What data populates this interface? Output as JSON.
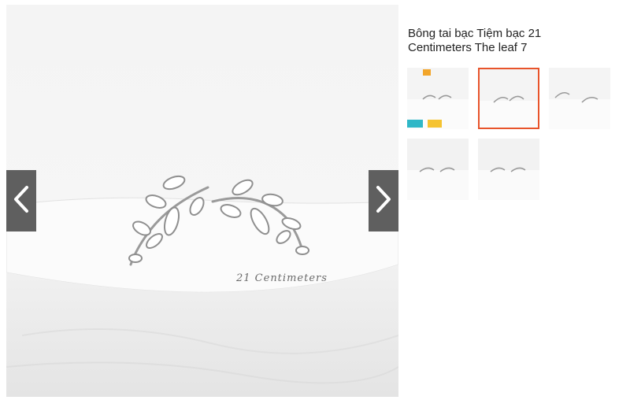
{
  "product": {
    "title": "Bông tai bạc Tiệm bạc 21 Centimeters The leaf 7",
    "brand_mark": "21 Centimeters"
  },
  "gallery": {
    "selected_index": 1,
    "thumbnails": [
      {
        "label": "thumbnail-1"
      },
      {
        "label": "thumbnail-2"
      },
      {
        "label": "thumbnail-3"
      },
      {
        "label": "thumbnail-4"
      },
      {
        "label": "thumbnail-5"
      }
    ]
  },
  "icons": {
    "prev": "chevron-left-icon",
    "next": "chevron-right-icon"
  },
  "colors": {
    "selected_border": "#e8542b",
    "nav_background": "#5f5f5f"
  }
}
